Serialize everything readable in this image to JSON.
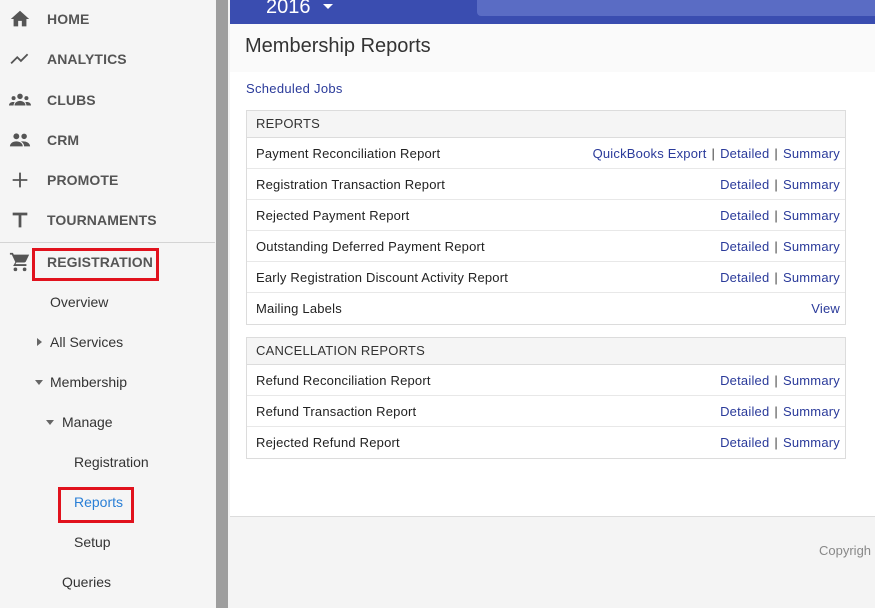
{
  "sidebar": {
    "nav": [
      {
        "label": "HOME",
        "icon": "home-icon"
      },
      {
        "label": "ANALYTICS",
        "icon": "trending-icon"
      },
      {
        "label": "CLUBS",
        "icon": "groups-icon"
      },
      {
        "label": "CRM",
        "icon": "people-icon"
      },
      {
        "label": "PROMOTE",
        "icon": "plus-icon"
      },
      {
        "label": "TOURNAMENTS",
        "icon": "t-letter-icon"
      },
      {
        "label": "REGISTRATION",
        "icon": "cart-icon"
      }
    ],
    "sub": {
      "overview": "Overview",
      "all_services": "All Services",
      "membership": "Membership",
      "manage": "Manage",
      "registration": "Registration",
      "reports": "Reports",
      "setup": "Setup",
      "queries": "Queries"
    },
    "active_color": "#2a7fd6",
    "highlight_color": "#e1121d"
  },
  "header": {
    "year": "2016",
    "bar_color": "#3a4db0"
  },
  "page": {
    "title": "Membership Reports",
    "scheduled_jobs": "Scheduled Jobs"
  },
  "reports": {
    "heading": "REPORTS",
    "rows": [
      {
        "label": "Payment Reconciliation Report",
        "links": [
          "QuickBooks Export",
          "Detailed",
          "Summary"
        ]
      },
      {
        "label": "Registration Transaction Report",
        "links": [
          "Detailed",
          "Summary"
        ]
      },
      {
        "label": "Rejected Payment Report",
        "links": [
          "Detailed",
          "Summary"
        ]
      },
      {
        "label": "Outstanding Deferred Payment Report",
        "links": [
          "Detailed",
          "Summary"
        ]
      },
      {
        "label": "Early Registration Discount Activity Report",
        "links": [
          "Detailed",
          "Summary"
        ]
      },
      {
        "label": "Mailing Labels",
        "links": [
          "View"
        ]
      }
    ]
  },
  "cancellation": {
    "heading": "CANCELLATION REPORTS",
    "rows": [
      {
        "label": "Refund Reconciliation Report",
        "links": [
          "Detailed",
          "Summary"
        ]
      },
      {
        "label": "Refund Transaction Report",
        "links": [
          "Detailed",
          "Summary"
        ]
      },
      {
        "label": "Rejected Refund Report",
        "links": [
          "Detailed",
          "Summary"
        ]
      }
    ]
  },
  "footer": {
    "copyright": "Copyrigh"
  }
}
